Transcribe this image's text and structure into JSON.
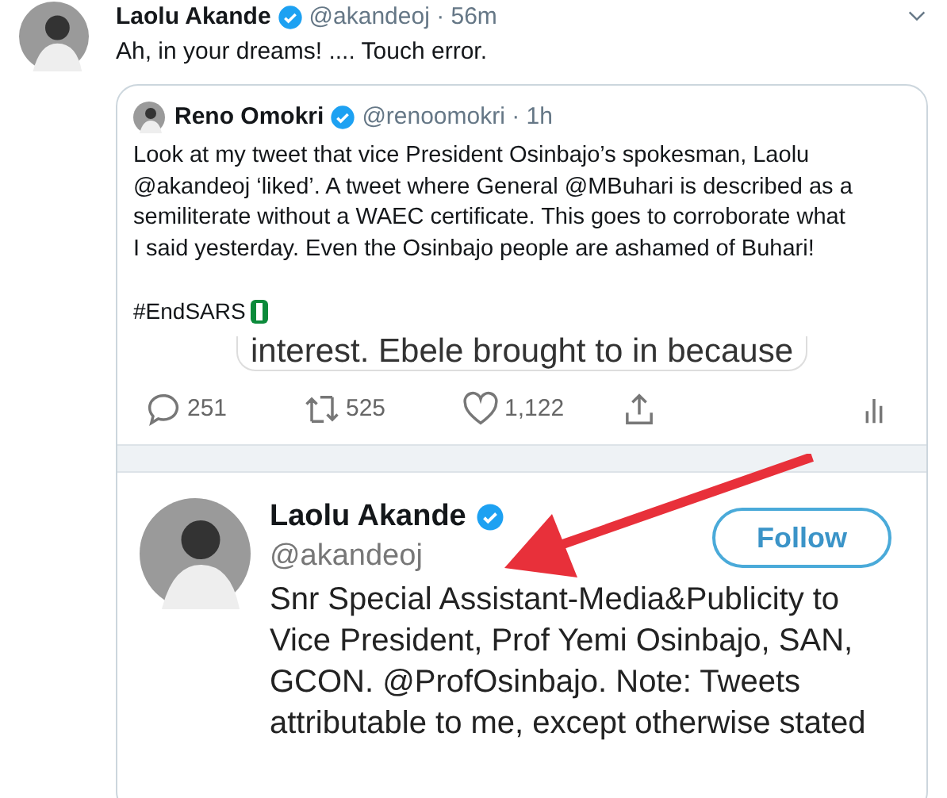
{
  "tweet": {
    "author": {
      "name": "Laolu Akande",
      "verified": true,
      "meta": "@akandeoj · 56m"
    },
    "text": "Ah, in your dreams! .... Touch error.",
    "quote": {
      "author": {
        "name": "Reno Omokri",
        "verified": true,
        "meta": "@renoomokri · 1h"
      },
      "text": "Look at my tweet that vice President Osinbajo’s spokesman, Laolu @akandeoj ‘liked’. A tweet where General @MBuhari is described as a semiliterate without a WAEC certificate. This goes to corroborate what I said yesterday. Even the Osinbajo people are ashamed of Buhari!",
      "hashtag": "#EndSARS",
      "screenshot": {
        "cut_text": "interest. Ebele brought to in because",
        "actions": [
          {
            "kind": "reply",
            "count": "251"
          },
          {
            "kind": "retweet",
            "count": "525"
          },
          {
            "kind": "like",
            "count": "1,122"
          },
          {
            "kind": "share"
          },
          {
            "kind": "stats"
          }
        ],
        "profile": {
          "name": "Laolu Akande",
          "verified": true,
          "handle": "@akandeoj",
          "follow_button": "Follow",
          "bio": "Snr Special Assistant-Media&Publicity to Vice President, Prof Yemi Osinbajo, SAN, GCON. @ProfOsinbajo. Note: Tweets attributable to me, except otherwise stated"
        }
      }
    }
  }
}
